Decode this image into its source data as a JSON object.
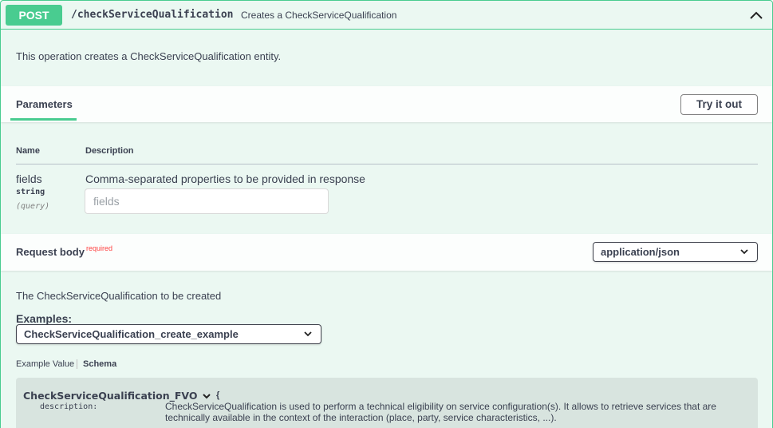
{
  "operation": {
    "method": "POST",
    "path": "/checkServiceQualification",
    "summary": "Creates a CheckServiceQualification",
    "description": "This operation creates a CheckServiceQualification entity."
  },
  "parameters": {
    "tab_label": "Parameters",
    "try_button": "Try it out",
    "columns": {
      "name": "Name",
      "description": "Description"
    },
    "items": [
      {
        "name": "fields",
        "type": "string",
        "in": "(query)",
        "description": "Comma-separated properties to be provided in response",
        "placeholder": "fields"
      }
    ]
  },
  "request_body": {
    "title": "Request body",
    "required_label": "required",
    "content_type": "application/json",
    "description": "The CheckServiceQualification to be created",
    "examples_label": "Examples:",
    "selected_example": "CheckServiceQualification_create_example",
    "tabs": {
      "example": "Example Value",
      "schema": "Schema"
    },
    "model": {
      "name": "CheckServiceQualification_FVO",
      "brace": "{",
      "property_name": "description:",
      "property_value": "CheckServiceQualification is used to perform a technical eligibility on service configuration(s). It allows to retrieve services that are technically available in the context of the interaction (place, party, service characteristics, ...)."
    }
  },
  "colors": {
    "post": "#49cc90",
    "block_bg": "#ebf8f2",
    "text": "#3b4151",
    "required": "#ff0000"
  },
  "icons": [
    "chevron-up-icon",
    "chevron-down-icon"
  ]
}
